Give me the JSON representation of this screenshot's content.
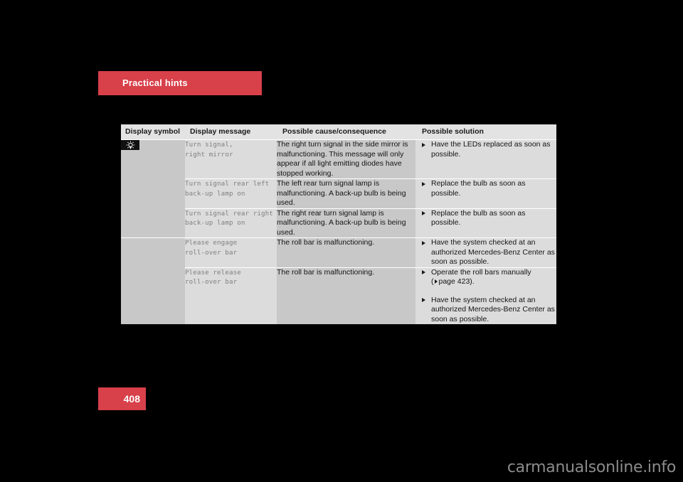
{
  "section": {
    "banner_label": "Practical hints",
    "banner_color": "#d8404a"
  },
  "page": {
    "number": "408",
    "tab_color": "#d8404a"
  },
  "watermark": {
    "text": "carmanualsonline.info"
  },
  "table": {
    "headers": {
      "display_symbol": "Display symbol",
      "display_message": "Display message",
      "possible_cause": "Possible cause/consequence",
      "possible_solution": "Possible solution"
    },
    "rows": [
      {
        "symbol_icon": "bulb-failure-icon",
        "display_message": "Turn signal,\nright mirror",
        "possible_cause": "The right turn signal in the side mirror is malfunctioning. This message will only appear if all light emitting diodes have stopped working.",
        "solutions": [
          {
            "text": "Have the LEDs replaced as soon as possible."
          }
        ]
      },
      {
        "symbol_icon": null,
        "display_message": "Turn signal rear left\nback-up lamp on",
        "possible_cause": "The left rear turn signal lamp is malfunctioning. A back-up bulb is being used.",
        "solutions": [
          {
            "text": "Replace the bulb as soon as possible."
          }
        ]
      },
      {
        "symbol_icon": null,
        "display_message": "Turn signal rear right\nback-up lamp on",
        "possible_cause": "The right rear turn signal lamp is malfunctioning. A back-up bulb is being used.",
        "solutions": [
          {
            "text": "Replace the bulb as soon as possible."
          }
        ]
      },
      {
        "symbol_icon": null,
        "display_message": "Please engage\nroll-over bar",
        "possible_cause": "The roll bar is malfunctioning.",
        "solutions": [
          {
            "text": "Have the system checked at an authorized Mercedes-Benz Center as soon as possible."
          }
        ]
      },
      {
        "symbol_icon": null,
        "display_message": "Please release\nroll-over bar",
        "possible_cause": "The roll bar is malfunctioning.",
        "solutions": [
          {
            "text": "Operate the roll bars manually",
            "page_ref_prefix": "(",
            "page_ref": "page 423",
            "page_ref_suffix": ")."
          },
          {
            "text": "Have the system checked at an authorized Mercedes-Benz Center as soon as possible."
          }
        ]
      }
    ]
  },
  "colors": {
    "accent_red": "#d8404a",
    "table_header_bg": "#e3e3e3",
    "col_odd_bg": "#c8c8c8",
    "col_even_bg": "#dcdcdc",
    "page_bg": "#000000"
  }
}
